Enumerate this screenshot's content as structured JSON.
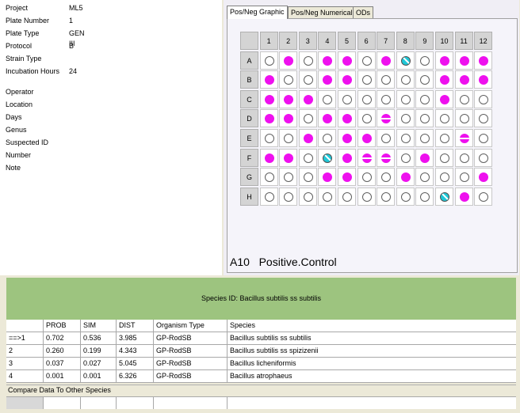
{
  "info": {
    "rows": [
      {
        "label": "Project",
        "value": "ML5"
      },
      {
        "label": "Plate Number",
        "value": "1"
      },
      {
        "label": "Plate Type",
        "value": "GEN III"
      },
      {
        "label": "Protocol",
        "value": "B"
      },
      {
        "label": "Strain Type",
        "value": ""
      },
      {
        "label": "Incubation Hours",
        "value": "24"
      },
      {
        "label": "Operator",
        "value": ""
      },
      {
        "label": "Location",
        "value": ""
      },
      {
        "label": "Days",
        "value": ""
      },
      {
        "label": "Genus",
        "value": ""
      },
      {
        "label": "Suspected ID",
        "value": ""
      },
      {
        "label": "Number",
        "value": ""
      },
      {
        "label": "Note",
        "value": ""
      }
    ]
  },
  "tabs": [
    {
      "label": "Pos/Neg Graphic",
      "active": true
    },
    {
      "label": "Pos/Neg Numerical",
      "active": false
    },
    {
      "label": "ODs",
      "active": false
    }
  ],
  "plate": {
    "col_headers": [
      "1",
      "2",
      "3",
      "4",
      "5",
      "6",
      "7",
      "8",
      "9",
      "10",
      "11",
      "12"
    ],
    "row_headers": [
      "A",
      "B",
      "C",
      "D",
      "E",
      "F",
      "G",
      "H"
    ],
    "wells": [
      "NPNPPNPCNPPP",
      "PNNPPNNNNPPP",
      "PPPNNNNNNPNN",
      "PPNPPNBNNNNN",
      "NNPNPPNNNNBN",
      "PPNCPBBNPNNN",
      "NNNPPNNPNNNP",
      "NNNNNNNNNCPN"
    ],
    "selected_well": "A10",
    "selected_label": "Positive.Control"
  },
  "species_id": "Species ID: Bacillus subtilis ss subtilis",
  "results": {
    "headers": [
      "",
      "PROB",
      "SIM",
      "DIST",
      "Organism Type",
      "Species"
    ],
    "rows": [
      [
        "==>1",
        "0.702",
        "0.536",
        "3.985",
        "GP-RodSB",
        "Bacillus subtilis ss subtilis"
      ],
      [
        "2",
        "0.260",
        "0.199",
        "4.343",
        "GP-RodSB",
        "Bacillus subtilis ss spizizenii"
      ],
      [
        "3",
        "0.037",
        "0.027",
        "5.045",
        "GP-RodSB",
        "Bacillus licheniformis"
      ],
      [
        "4",
        "0.001",
        "0.001",
        "6.326",
        "GP-RodSB",
        "Bacillus atrophaeus"
      ]
    ]
  },
  "compare_label": "Compare Data To Other Species",
  "colors": {
    "positive": "#ee10ee",
    "borderline": "#ee10ee",
    "control": "#1fc8d8",
    "species_bar": "#9dc47f"
  }
}
